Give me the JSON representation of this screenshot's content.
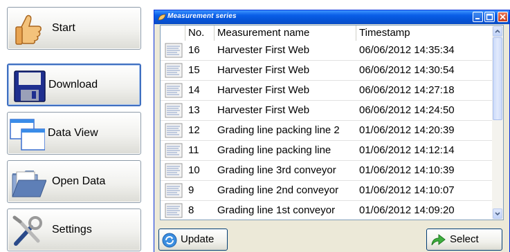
{
  "nav": {
    "items": [
      {
        "label": "Start",
        "icon": "thumbs-up-icon"
      },
      {
        "label": "Download",
        "icon": "floppy-disk-icon"
      },
      {
        "label": "Data View",
        "icon": "windows-icon"
      },
      {
        "label": "Open Data",
        "icon": "folder-icon"
      },
      {
        "label": "Settings",
        "icon": "tools-icon"
      }
    ],
    "active_index": 1
  },
  "window": {
    "title": "Measurement series",
    "columns": [
      "No.",
      "Measurement name",
      "Timestamp"
    ],
    "rows": [
      {
        "no": "16",
        "name": "Harvester First Web",
        "timestamp": "06/06/2012 14:35:34"
      },
      {
        "no": "15",
        "name": "Harvester First Web",
        "timestamp": "06/06/2012 14:30:54"
      },
      {
        "no": "14",
        "name": "Harvester First Web",
        "timestamp": "06/06/2012 14:27:18"
      },
      {
        "no": "13",
        "name": "Harvester First Web",
        "timestamp": "06/06/2012 14:24:50"
      },
      {
        "no": "12",
        "name": "Grading line packing line 2",
        "timestamp": "01/06/2012 14:20:39"
      },
      {
        "no": "11",
        "name": "Grading line packing line",
        "timestamp": "01/06/2012 14:12:14"
      },
      {
        "no": "10",
        "name": "Grading line 3rd conveyor",
        "timestamp": "01/06/2012 14:10:39"
      },
      {
        "no": "9",
        "name": "Grading line 2nd conveyor",
        "timestamp": "01/06/2012 14:10:07"
      },
      {
        "no": "8",
        "name": "Grading line 1st conveyor",
        "timestamp": "01/06/2012 14:09:20"
      }
    ],
    "update_label": "Update",
    "select_label": "Select"
  },
  "colors": {
    "titlebar": "#0a5fe8",
    "active_border": "#3f6fc0",
    "select_arrow": "#2f9a2f",
    "update_icon": "#2f7fd8"
  }
}
